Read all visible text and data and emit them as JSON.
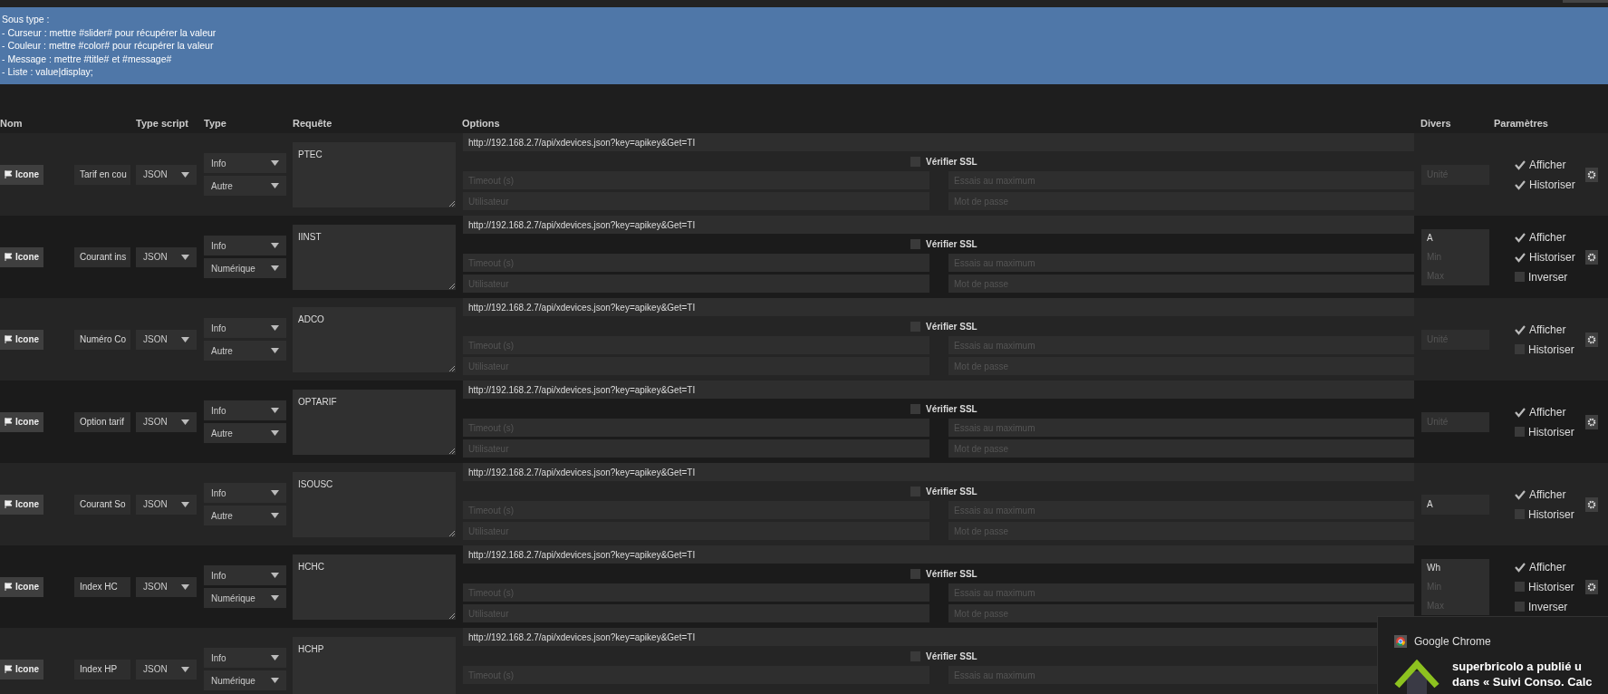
{
  "info_banner": {
    "lines": [
      "Sous type :",
      "- Curseur : mettre #slider# pour récupérer la valeur",
      "- Couleur : mettre #color# pour récupérer la valeur",
      "- Message : mettre #title# et #message#",
      "- Liste : value|display;"
    ]
  },
  "table": {
    "columns": [
      "Nom",
      "Type script",
      "Type",
      "Requête",
      "Options",
      "Divers",
      "Paramètres"
    ],
    "rows": [
      {
        "icon_button": "Icone",
        "name": "Tarif en cou",
        "script": "JSON",
        "type": "Info",
        "subtype": "Autre",
        "request": "PTEC",
        "url": "http://192.168.2.7/api/xdevices.json?key=apikey&Get=TI",
        "ssl": {
          "label": "Vérifier SSL",
          "checked": false
        },
        "fields": [
          [
            "Timeout (s)",
            "Essais au maximum"
          ],
          [
            "Utilisateur",
            "Mot de passe"
          ]
        ],
        "divers": {
          "kind": "unit",
          "unit_placeholder": "Unité"
        },
        "params": [
          {
            "label": "Afficher",
            "checked": true
          },
          {
            "label": "Historiser",
            "checked": true
          }
        ]
      },
      {
        "icon_button": "Icone",
        "name": "Courant ins",
        "script": "JSON",
        "type": "Info",
        "subtype": "Numérique",
        "request": "IINST",
        "url": "http://192.168.2.7/api/xdevices.json?key=apikey&Get=TI",
        "ssl": {
          "label": "Vérifier SSL",
          "checked": false
        },
        "fields": [
          [
            "Timeout (s)",
            "Essais au maximum"
          ],
          [
            "Utilisateur",
            "Mot de passe"
          ]
        ],
        "divers": {
          "kind": "numeric",
          "unit": "A",
          "min_placeholder": "Min",
          "max_placeholder": "Max"
        },
        "params": [
          {
            "label": "Afficher",
            "checked": true
          },
          {
            "label": "Historiser",
            "checked": true
          },
          {
            "label": "Inverser",
            "checked": false
          }
        ]
      },
      {
        "icon_button": "Icone",
        "name": "Numéro Co",
        "script": "JSON",
        "type": "Info",
        "subtype": "Autre",
        "request": "ADCO",
        "url": "http://192.168.2.7/api/xdevices.json?key=apikey&Get=TI",
        "ssl": {
          "label": "Vérifier SSL",
          "checked": false
        },
        "fields": [
          [
            "Timeout (s)",
            "Essais au maximum"
          ],
          [
            "Utilisateur",
            "Mot de passe"
          ]
        ],
        "divers": {
          "kind": "unit",
          "unit_placeholder": "Unité"
        },
        "params": [
          {
            "label": "Afficher",
            "checked": true
          },
          {
            "label": "Historiser",
            "checked": false
          }
        ]
      },
      {
        "icon_button": "Icone",
        "name": "Option tarif",
        "script": "JSON",
        "type": "Info",
        "subtype": "Autre",
        "request": "OPTARIF",
        "url": "http://192.168.2.7/api/xdevices.json?key=apikey&Get=TI",
        "ssl": {
          "label": "Vérifier SSL",
          "checked": false
        },
        "fields": [
          [
            "Timeout (s)",
            "Essais au maximum"
          ],
          [
            "Utilisateur",
            "Mot de passe"
          ]
        ],
        "divers": {
          "kind": "unit",
          "unit_placeholder": "Unité"
        },
        "params": [
          {
            "label": "Afficher",
            "checked": true
          },
          {
            "label": "Historiser",
            "checked": false
          }
        ]
      },
      {
        "icon_button": "Icone",
        "name": "Courant So",
        "script": "JSON",
        "type": "Info",
        "subtype": "Autre",
        "request": "ISOUSC",
        "url": "http://192.168.2.7/api/xdevices.json?key=apikey&Get=TI",
        "ssl": {
          "label": "Vérifier SSL",
          "checked": false
        },
        "fields": [
          [
            "Timeout (s)",
            "Essais au maximum"
          ],
          [
            "Utilisateur",
            "Mot de passe"
          ]
        ],
        "divers": {
          "kind": "unit",
          "unit": "A"
        },
        "params": [
          {
            "label": "Afficher",
            "checked": true
          },
          {
            "label": "Historiser",
            "checked": false
          }
        ]
      },
      {
        "icon_button": "Icone",
        "name": "Index HC",
        "script": "JSON",
        "type": "Info",
        "subtype": "Numérique",
        "request": "HCHC",
        "url": "http://192.168.2.7/api/xdevices.json?key=apikey&Get=TI",
        "ssl": {
          "label": "Vérifier SSL",
          "checked": false
        },
        "fields": [
          [
            "Timeout (s)",
            "Essais au maximum"
          ],
          [
            "Utilisateur",
            "Mot de passe"
          ]
        ],
        "divers": {
          "kind": "numeric",
          "unit": "Wh",
          "min_placeholder": "Min",
          "max_placeholder": "Max"
        },
        "params": [
          {
            "label": "Afficher",
            "checked": true
          },
          {
            "label": "Historiser",
            "checked": false
          },
          {
            "label": "Inverser",
            "checked": false
          }
        ]
      },
      {
        "icon_button": "Icone",
        "name": "Index HP",
        "script": "JSON",
        "type": "Info",
        "subtype": "Numérique",
        "request": "HCHP",
        "url": "http://192.168.2.7/api/xdevices.json?key=apikey&Get=TI",
        "ssl": {
          "label": "Vérifier SSL",
          "checked": false
        },
        "fields": [
          [
            "Timeout (s)",
            "Essais au maximum"
          ]
        ]
      }
    ]
  },
  "notification": {
    "app": "Google Chrome",
    "lines": [
      "superbricolo a publié u",
      "dans « Suivi Conso. Calc"
    ]
  }
}
